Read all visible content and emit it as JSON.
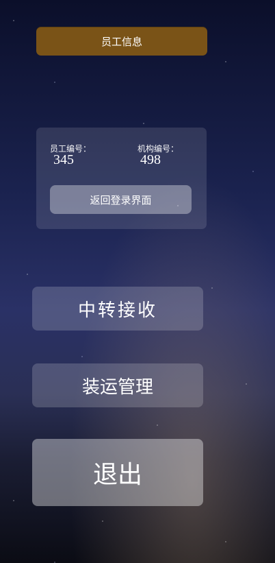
{
  "header": {
    "title": "员工信息"
  },
  "employee": {
    "id_label": "员工编号：",
    "id_value": "345",
    "org_label": "机构编号：",
    "org_value": "498"
  },
  "buttons": {
    "back_to_login": "返回登录界面",
    "transfer_receive": "中转接收",
    "shipping_manage": "装运管理",
    "exit": "退出"
  },
  "colors": {
    "header_bg": "#7a5317",
    "sky_top": "#0b0f2a",
    "sky_mid": "#2a3166"
  }
}
